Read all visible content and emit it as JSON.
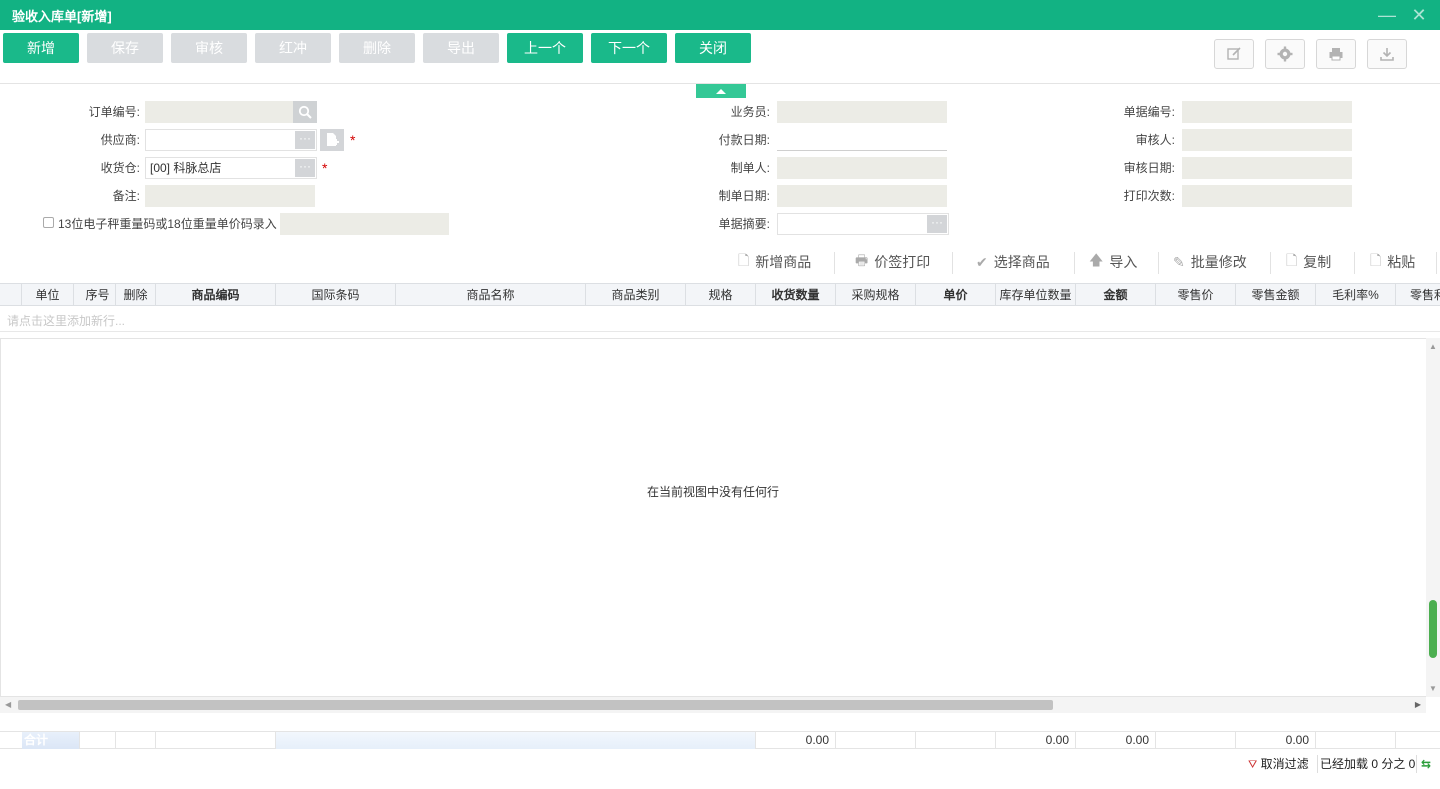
{
  "window": {
    "title": "验收入库单[新增]"
  },
  "toolbar": {
    "buttons": [
      {
        "label": "新增",
        "state": "enabled"
      },
      {
        "label": "保存",
        "state": "disabled"
      },
      {
        "label": "审核",
        "state": "disabled"
      },
      {
        "label": "红冲",
        "state": "disabled"
      },
      {
        "label": "删除",
        "state": "disabled"
      },
      {
        "label": "导出",
        "state": "disabled"
      },
      {
        "label": "上一个",
        "state": "enabled"
      },
      {
        "label": "下一个",
        "state": "enabled"
      },
      {
        "label": "关闭",
        "state": "enabled"
      }
    ],
    "icons": [
      "edit-icon",
      "gear-icon",
      "printer-icon",
      "download-icon"
    ]
  },
  "form": {
    "order_no": {
      "label": "订单编号:",
      "value": ""
    },
    "supplier": {
      "label": "供应商:",
      "value": ""
    },
    "warehouse": {
      "label": "收货仓:",
      "value": "[00] 科脉总店"
    },
    "remark": {
      "label": "备注:",
      "value": ""
    },
    "weight_code": {
      "label": "13位电子秤重量码或18位重量单价码录入",
      "checked": false
    },
    "salesman": {
      "label": "业务员:",
      "value": ""
    },
    "pay_date": {
      "label": "付款日期:",
      "value": ""
    },
    "maker": {
      "label": "制单人:",
      "value": ""
    },
    "make_date": {
      "label": "制单日期:",
      "value": ""
    },
    "summary": {
      "label": "单据摘要:",
      "value": ""
    },
    "doc_no": {
      "label": "单据编号:",
      "value": ""
    },
    "auditor": {
      "label": "审核人:",
      "value": ""
    },
    "audit_date": {
      "label": "审核日期:",
      "value": ""
    },
    "print_count": {
      "label": "打印次数:",
      "value": ""
    }
  },
  "grid_toolbar": {
    "add_item": "新增商品",
    "print_tag": "价签打印",
    "select_item": "选择商品",
    "import": "导入",
    "batch_edit": "批量修改",
    "copy": "复制",
    "paste": "粘贴"
  },
  "grid": {
    "columns": [
      "单位",
      "序号",
      "删除",
      "商品编码",
      "国际条码",
      "商品名称",
      "商品类别",
      "规格",
      "收货数量",
      "采购规格",
      "单价",
      "库存单位数量",
      "金额",
      "零售价",
      "零售金额",
      "毛利率%",
      "零售利"
    ],
    "add_row_hint": "请点击这里添加新行...",
    "empty_message": "在当前视图中没有任何行",
    "totals": {
      "label": "合计",
      "qty": "0.00",
      "stock_qty": "0.00",
      "amount": "0.00",
      "retail_amount": "0.00"
    }
  },
  "status": {
    "cancel_filter": "取消过滤",
    "loaded": "已经加载 0 分之 0"
  }
}
